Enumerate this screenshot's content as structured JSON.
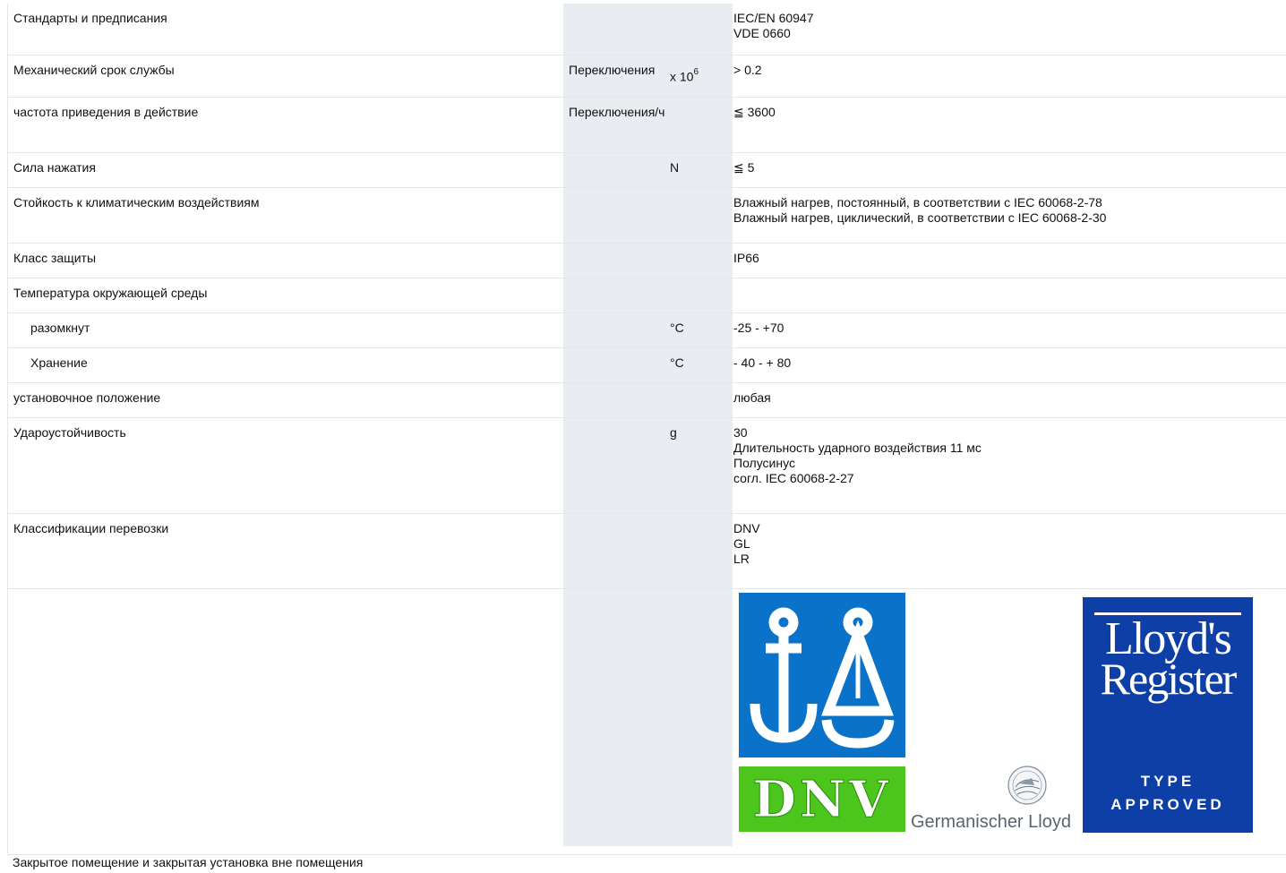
{
  "rows": [
    {
      "name": "Стандарты и предписания",
      "unit": "",
      "values": [
        "IEC/EN 60947",
        "VDE 0660"
      ]
    },
    {
      "name": "Механический срок службы",
      "unit": "Переключения",
      "unit_suffix": "x 10",
      "unit_sup": "6",
      "values": [
        "> 0.2"
      ]
    },
    {
      "name": "частота приведения в действие",
      "unit": "Переключения/ч",
      "values": [
        "≦ 3600"
      ]
    },
    {
      "name": "Сила нажатия",
      "unit": "N",
      "values": [
        "≦ 5"
      ]
    },
    {
      "name": "Стойкость к климатическим воздействиям",
      "unit": "",
      "values": [
        "Влажный нагрев, постоянный, в соответствии с IEC 60068-2-78",
        "Влажный нагрев, циклический, в соответствии с IEC 60068-2-30"
      ]
    },
    {
      "name": "Класс защиты",
      "unit": "",
      "values": [
        "IP66"
      ]
    },
    {
      "name": "Температура окружающей среды",
      "unit": "",
      "values": []
    },
    {
      "name": "разомкнут",
      "unit": "°C",
      "values": [
        "-25 - +70"
      ]
    },
    {
      "name": "Хранение",
      "unit": "°C",
      "values": [
        "- 40 - + 80"
      ]
    },
    {
      "name": "установочное положение",
      "unit": "",
      "values": [
        "любая"
      ]
    },
    {
      "name": "Удароустойчивость",
      "unit": "g",
      "values": [
        "30",
        "Длительность ударного воздействия 11 мс",
        "Полусинус",
        "согл. IEC 60068-2-27"
      ]
    },
    {
      "name": "Классификации перевозки",
      "unit": "",
      "values": [
        "DNV",
        "GL",
        "LR"
      ]
    }
  ],
  "logos": {
    "dnv": "DNV",
    "gl": "Germanischer Lloyd",
    "lr_line1": "Lloyd's",
    "lr_line2": "Register",
    "lr_type": "TYPE",
    "lr_approved": "APPROVED"
  },
  "footer": "Закрытое помещение и закрытая установка вне помещения",
  "colors": {
    "dnv_blue": "#0a72c8",
    "dnv_green": "#4cc51d",
    "lr_blue": "#0d3fa6",
    "grey_column": "#e9ecf0"
  }
}
